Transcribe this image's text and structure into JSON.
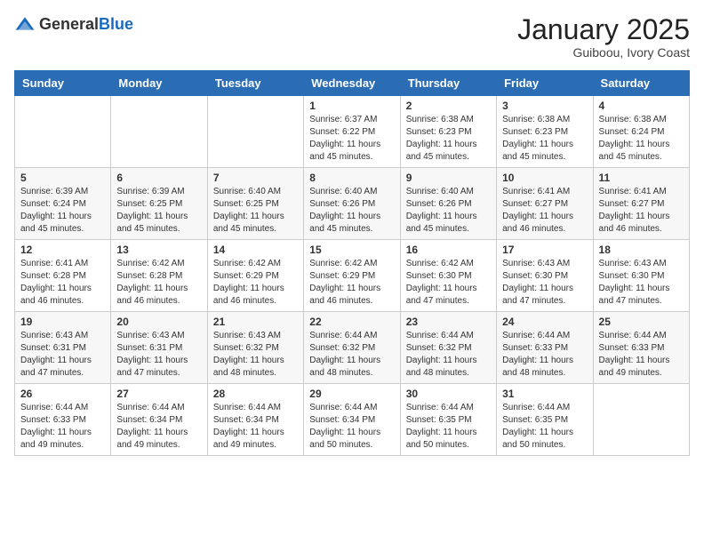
{
  "logo": {
    "general": "General",
    "blue": "Blue"
  },
  "title": "January 2025",
  "subtitle": "Guiboou, Ivory Coast",
  "days_of_week": [
    "Sunday",
    "Monday",
    "Tuesday",
    "Wednesday",
    "Thursday",
    "Friday",
    "Saturday"
  ],
  "weeks": [
    [
      {
        "day": "",
        "info": ""
      },
      {
        "day": "",
        "info": ""
      },
      {
        "day": "",
        "info": ""
      },
      {
        "day": "1",
        "info": "Sunrise: 6:37 AM\nSunset: 6:22 PM\nDaylight: 11 hours and 45 minutes."
      },
      {
        "day": "2",
        "info": "Sunrise: 6:38 AM\nSunset: 6:23 PM\nDaylight: 11 hours and 45 minutes."
      },
      {
        "day": "3",
        "info": "Sunrise: 6:38 AM\nSunset: 6:23 PM\nDaylight: 11 hours and 45 minutes."
      },
      {
        "day": "4",
        "info": "Sunrise: 6:38 AM\nSunset: 6:24 PM\nDaylight: 11 hours and 45 minutes."
      }
    ],
    [
      {
        "day": "5",
        "info": "Sunrise: 6:39 AM\nSunset: 6:24 PM\nDaylight: 11 hours and 45 minutes."
      },
      {
        "day": "6",
        "info": "Sunrise: 6:39 AM\nSunset: 6:25 PM\nDaylight: 11 hours and 45 minutes."
      },
      {
        "day": "7",
        "info": "Sunrise: 6:40 AM\nSunset: 6:25 PM\nDaylight: 11 hours and 45 minutes."
      },
      {
        "day": "8",
        "info": "Sunrise: 6:40 AM\nSunset: 6:26 PM\nDaylight: 11 hours and 45 minutes."
      },
      {
        "day": "9",
        "info": "Sunrise: 6:40 AM\nSunset: 6:26 PM\nDaylight: 11 hours and 45 minutes."
      },
      {
        "day": "10",
        "info": "Sunrise: 6:41 AM\nSunset: 6:27 PM\nDaylight: 11 hours and 46 minutes."
      },
      {
        "day": "11",
        "info": "Sunrise: 6:41 AM\nSunset: 6:27 PM\nDaylight: 11 hours and 46 minutes."
      }
    ],
    [
      {
        "day": "12",
        "info": "Sunrise: 6:41 AM\nSunset: 6:28 PM\nDaylight: 11 hours and 46 minutes."
      },
      {
        "day": "13",
        "info": "Sunrise: 6:42 AM\nSunset: 6:28 PM\nDaylight: 11 hours and 46 minutes."
      },
      {
        "day": "14",
        "info": "Sunrise: 6:42 AM\nSunset: 6:29 PM\nDaylight: 11 hours and 46 minutes."
      },
      {
        "day": "15",
        "info": "Sunrise: 6:42 AM\nSunset: 6:29 PM\nDaylight: 11 hours and 46 minutes."
      },
      {
        "day": "16",
        "info": "Sunrise: 6:42 AM\nSunset: 6:30 PM\nDaylight: 11 hours and 47 minutes."
      },
      {
        "day": "17",
        "info": "Sunrise: 6:43 AM\nSunset: 6:30 PM\nDaylight: 11 hours and 47 minutes."
      },
      {
        "day": "18",
        "info": "Sunrise: 6:43 AM\nSunset: 6:30 PM\nDaylight: 11 hours and 47 minutes."
      }
    ],
    [
      {
        "day": "19",
        "info": "Sunrise: 6:43 AM\nSunset: 6:31 PM\nDaylight: 11 hours and 47 minutes."
      },
      {
        "day": "20",
        "info": "Sunrise: 6:43 AM\nSunset: 6:31 PM\nDaylight: 11 hours and 47 minutes."
      },
      {
        "day": "21",
        "info": "Sunrise: 6:43 AM\nSunset: 6:32 PM\nDaylight: 11 hours and 48 minutes."
      },
      {
        "day": "22",
        "info": "Sunrise: 6:44 AM\nSunset: 6:32 PM\nDaylight: 11 hours and 48 minutes."
      },
      {
        "day": "23",
        "info": "Sunrise: 6:44 AM\nSunset: 6:32 PM\nDaylight: 11 hours and 48 minutes."
      },
      {
        "day": "24",
        "info": "Sunrise: 6:44 AM\nSunset: 6:33 PM\nDaylight: 11 hours and 48 minutes."
      },
      {
        "day": "25",
        "info": "Sunrise: 6:44 AM\nSunset: 6:33 PM\nDaylight: 11 hours and 49 minutes."
      }
    ],
    [
      {
        "day": "26",
        "info": "Sunrise: 6:44 AM\nSunset: 6:33 PM\nDaylight: 11 hours and 49 minutes."
      },
      {
        "day": "27",
        "info": "Sunrise: 6:44 AM\nSunset: 6:34 PM\nDaylight: 11 hours and 49 minutes."
      },
      {
        "day": "28",
        "info": "Sunrise: 6:44 AM\nSunset: 6:34 PM\nDaylight: 11 hours and 49 minutes."
      },
      {
        "day": "29",
        "info": "Sunrise: 6:44 AM\nSunset: 6:34 PM\nDaylight: 11 hours and 50 minutes."
      },
      {
        "day": "30",
        "info": "Sunrise: 6:44 AM\nSunset: 6:35 PM\nDaylight: 11 hours and 50 minutes."
      },
      {
        "day": "31",
        "info": "Sunrise: 6:44 AM\nSunset: 6:35 PM\nDaylight: 11 hours and 50 minutes."
      },
      {
        "day": "",
        "info": ""
      }
    ]
  ]
}
